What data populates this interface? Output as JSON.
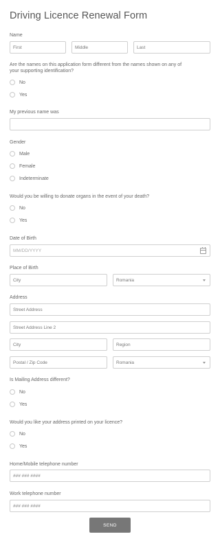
{
  "form": {
    "title": "Driving Licence Renewal Form",
    "name": {
      "label": "Name",
      "first_placeholder": "First",
      "middle_placeholder": "Middle",
      "last_placeholder": "Last"
    },
    "names_different": {
      "question_line1": "Are the names on this application form different from the names shown on any of",
      "question_line2": "your supporting identification?",
      "options": [
        "No",
        "Yes"
      ]
    },
    "previous_name": {
      "label": "My previous name was",
      "value": ""
    },
    "gender": {
      "label": "Gender",
      "options": [
        "Male",
        "Female",
        "Indeterminate"
      ]
    },
    "organ_donation": {
      "question": "Would you be willing to donate organs in the event of your death?",
      "options": [
        "No",
        "Yes"
      ]
    },
    "dob": {
      "label": "Date of Birth",
      "placeholder": "MM/DD/YYYY",
      "icon": "calendar-icon"
    },
    "place_of_birth": {
      "label": "Place of Birth",
      "city_placeholder": "City",
      "country_value": "Romania"
    },
    "address": {
      "label": "Address",
      "street_placeholder": "Street Address",
      "street2_placeholder": "Street Address Line 2",
      "city_placeholder": "City",
      "region_placeholder": "Region",
      "postal_placeholder": "Postal / Zip Code",
      "country_value": "Romania"
    },
    "mailing_different": {
      "question": "Is Mailing Address different?",
      "options": [
        "No",
        "Yes"
      ]
    },
    "address_printed": {
      "question": "Would you like your address printed on your licence?",
      "options": [
        "No",
        "Yes"
      ]
    },
    "home_phone": {
      "label": "Home/Mobile telephone number",
      "placeholder": "### ### ####"
    },
    "work_phone": {
      "label": "Work telephone number",
      "placeholder": "### ### ####"
    },
    "submit_label": "SEND"
  },
  "colors": {
    "button_bg": "#777777",
    "border": "#cfcfcf",
    "text": "#555555"
  }
}
